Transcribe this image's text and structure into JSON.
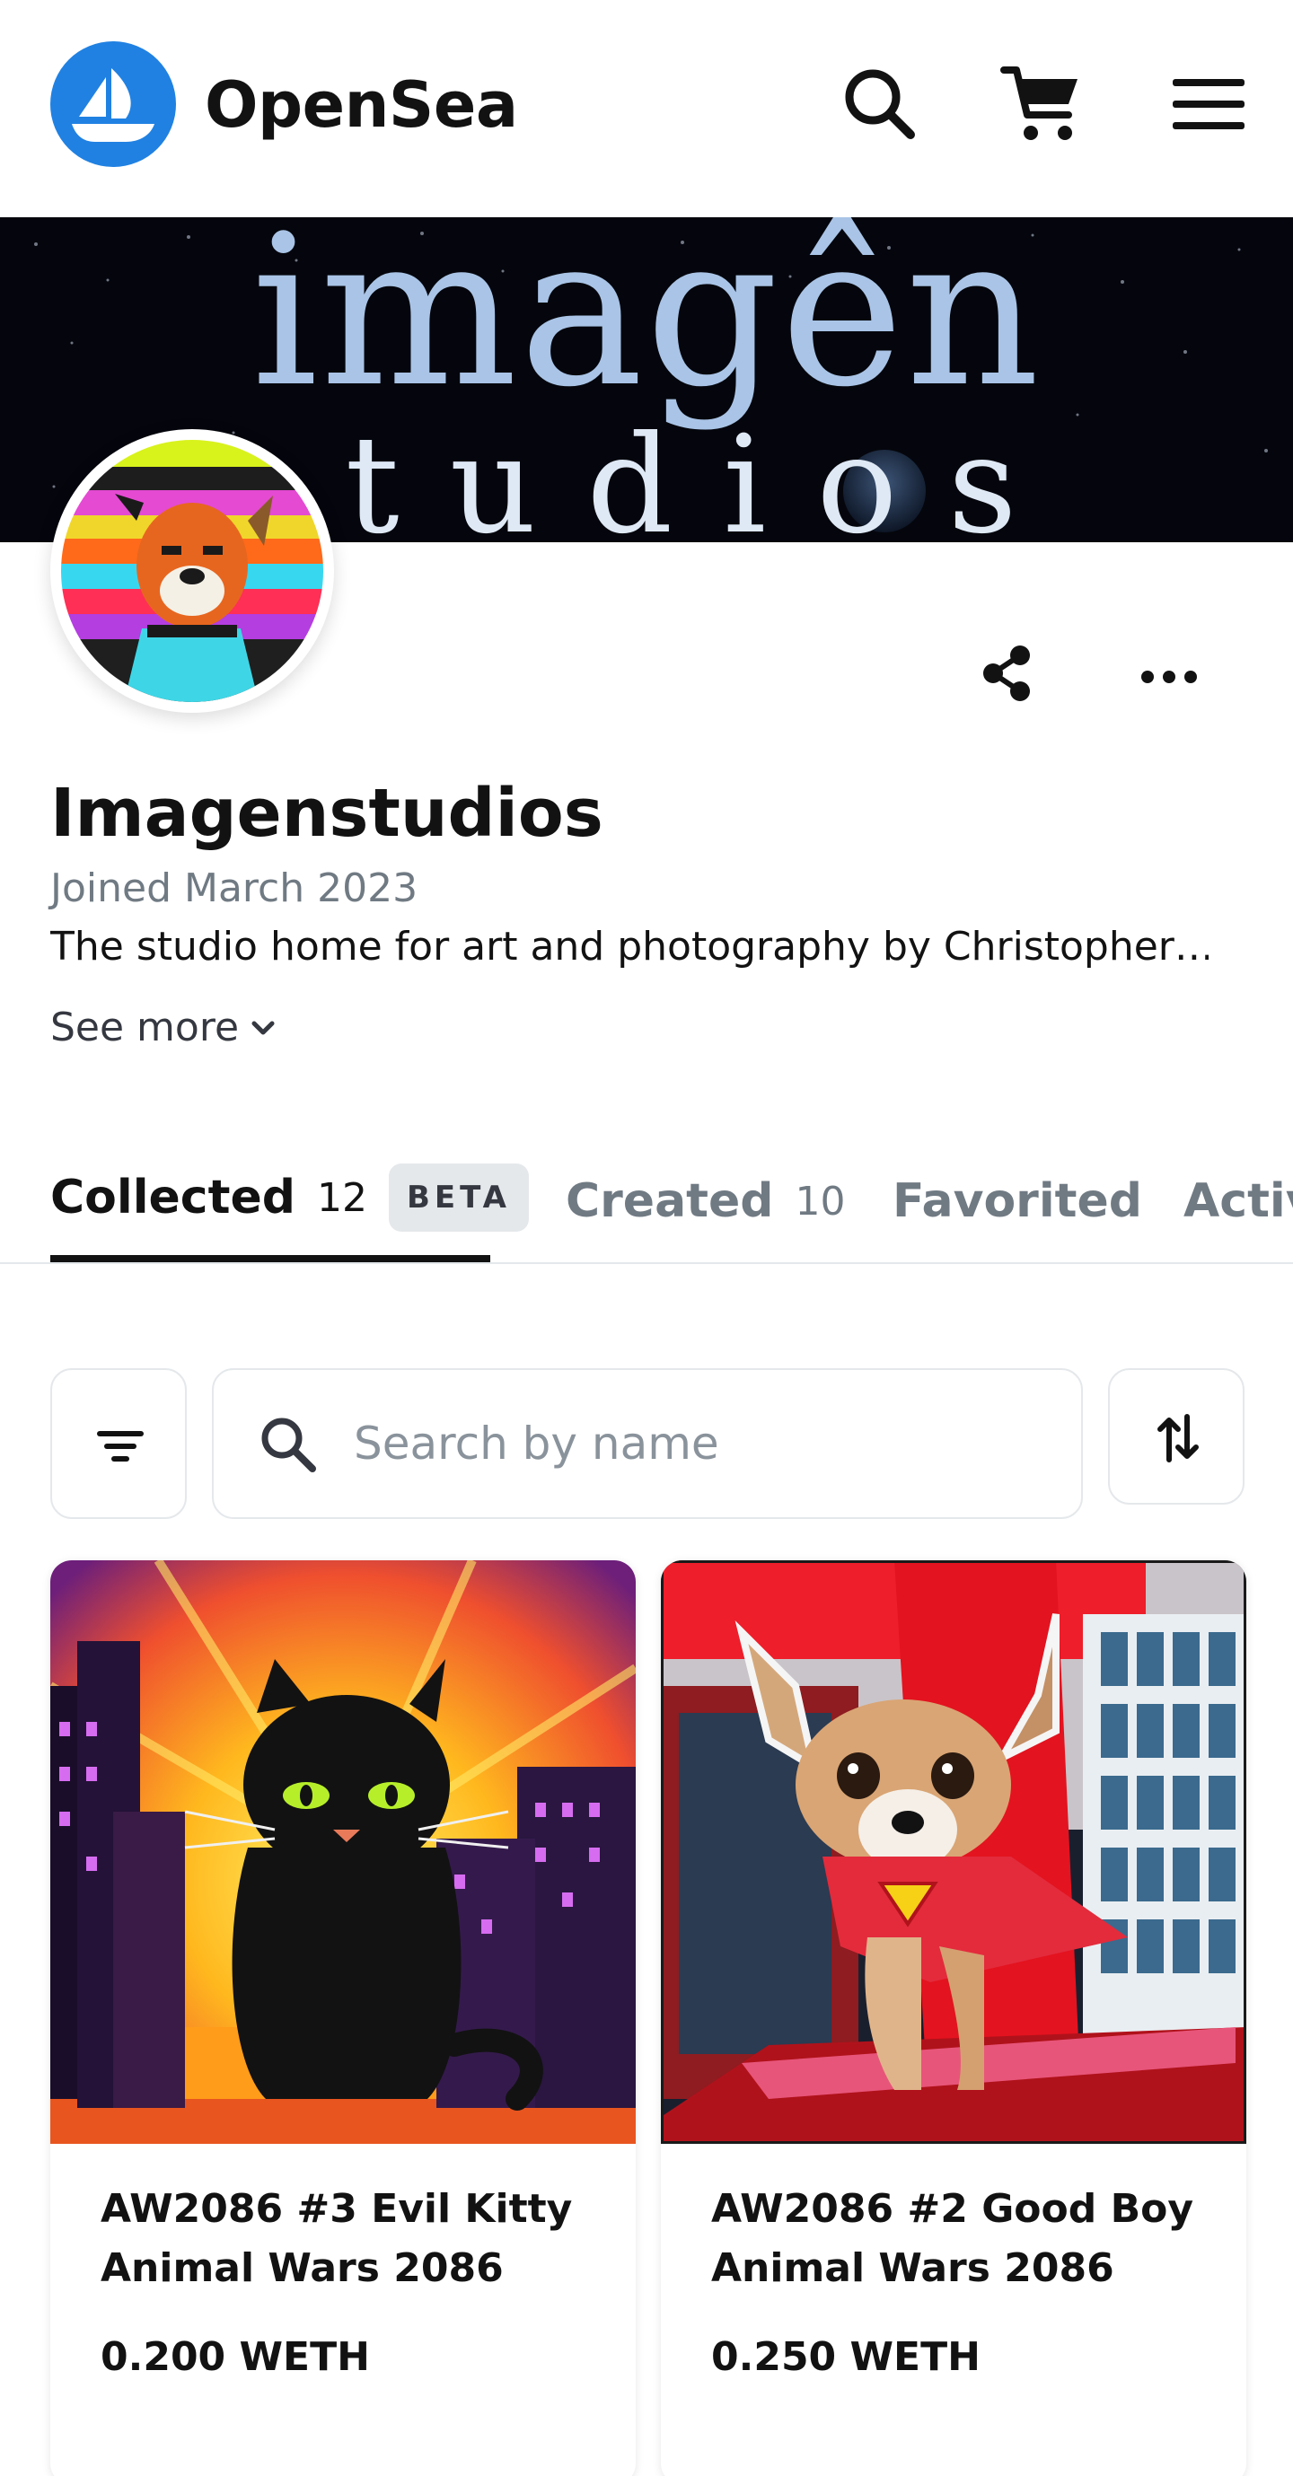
{
  "header": {
    "brand": "OpenSea",
    "icons": [
      "search-icon",
      "cart-icon",
      "menu-icon"
    ]
  },
  "banner": {
    "line1": "imagên",
    "line2": "studios"
  },
  "profile": {
    "name": "Imagenstudios",
    "joined": "Joined March 2023",
    "bio": "The studio home for art and photography by Christopher…",
    "see_more": "See more"
  },
  "tabs": [
    {
      "label": "Collected",
      "count": "12",
      "badge": "BETA",
      "active": true
    },
    {
      "label": "Created",
      "count": "10"
    },
    {
      "label": "Favorited"
    },
    {
      "label": "Activity"
    }
  ],
  "toolbar": {
    "search_placeholder": "Search by name"
  },
  "items": [
    {
      "title": "AW2086 #3 Evil Kitty Animal Wars 2086",
      "price": "0.200 WETH"
    },
    {
      "title": "AW2086 #2 Good Boy Animal Wars 2086",
      "price": "0.250 WETH"
    }
  ],
  "colors": {
    "brand_blue": "#2081E2",
    "text_primary": "#121212",
    "text_secondary": "#707a83",
    "border": "#e5e8eb",
    "banner_bg": "#05060d",
    "banner_text": "#a9c4e6"
  }
}
